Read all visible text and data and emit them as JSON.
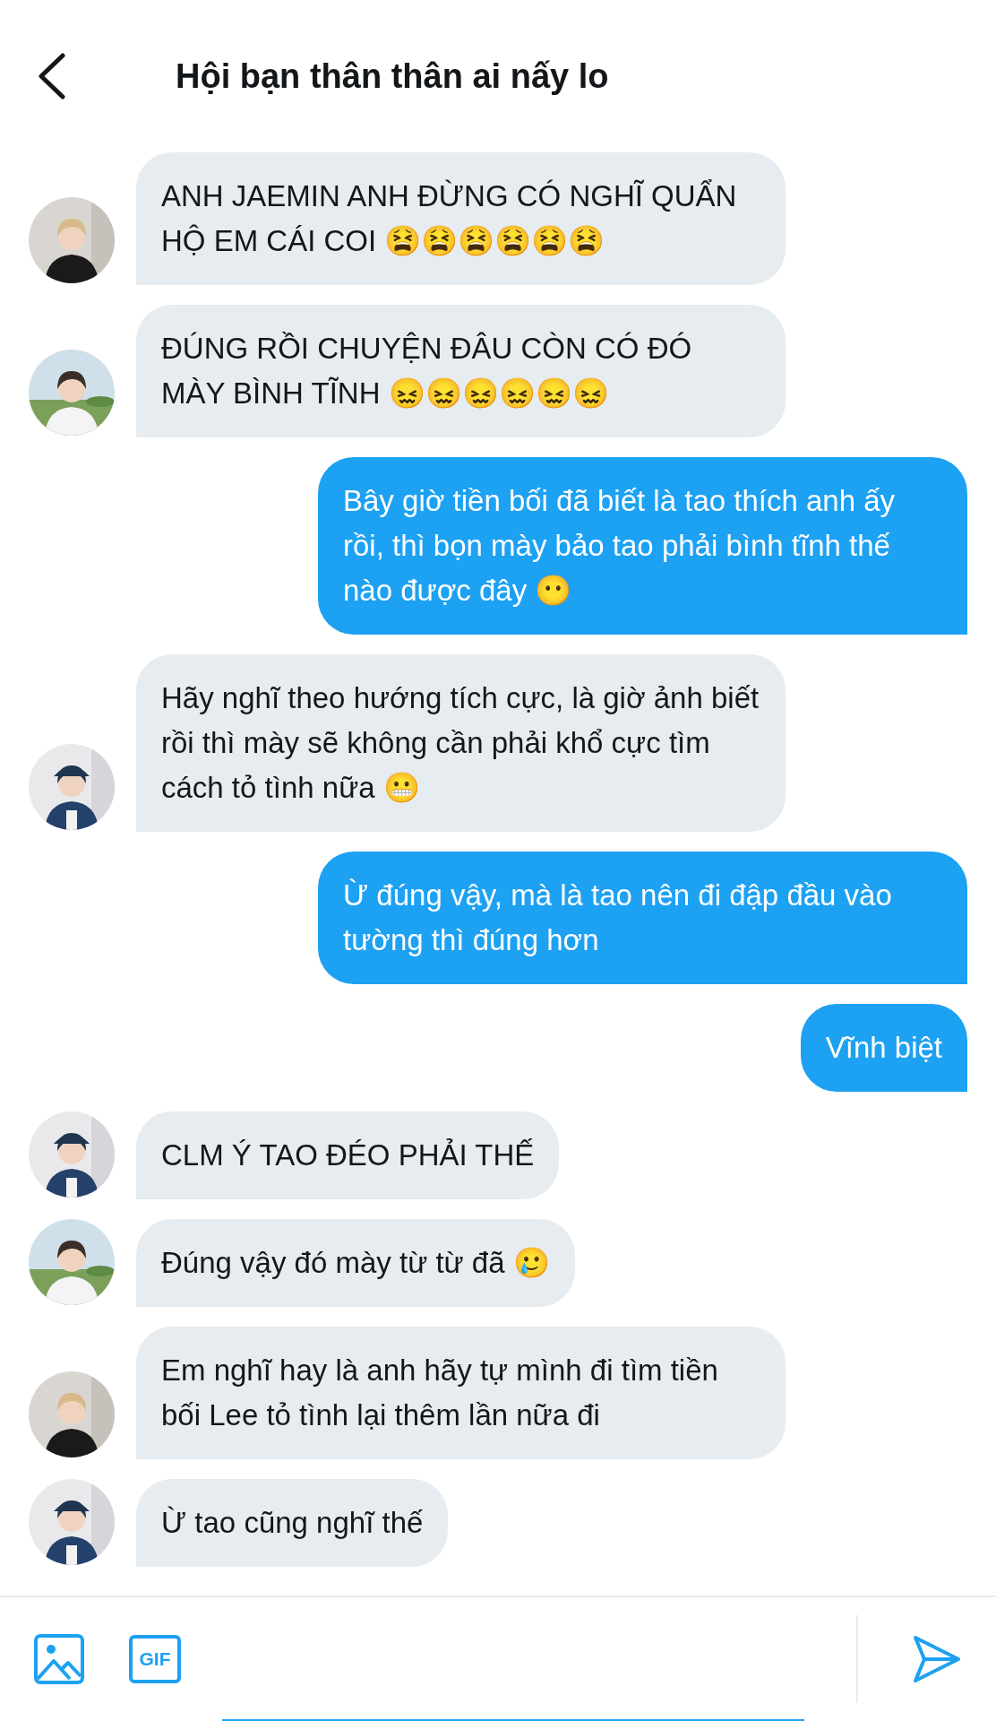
{
  "header": {
    "title": "Hội bạn thân thân ai nấy lo"
  },
  "messages": [
    {
      "kind": "received",
      "text": "ANH JAEMIN ANH ĐỪNG CÓ NGHĨ QUẨN HỘ EM CÁI COI 😫😫😫😫😫😫"
    },
    {
      "kind": "received",
      "text": "ĐÚNG RỒI CHUYỆN ĐÂU CÒN CÓ ĐÓ MÀY BÌNH TĨNH 😖😖😖😖😖😖"
    },
    {
      "kind": "sent",
      "text": "Bây giờ tiền bối đã biết là tao thích anh ấy rồi, thì bọn mày bảo tao phải bình tĩnh thế nào được đây 😶"
    },
    {
      "kind": "received",
      "text": "Hãy nghĩ theo hướng tích cực, là giờ ảnh biết rồi thì mày sẽ không cần phải khổ cực tìm cách tỏ tình nữa 😬"
    },
    {
      "kind": "sent",
      "text": "Ừ đúng vậy, mà là tao nên đi đập đầu vào tường thì đúng hơn"
    },
    {
      "kind": "sent",
      "text": "Vĩnh biệt"
    },
    {
      "kind": "received",
      "text": "CLM Ý TAO ĐÉO PHẢI THẾ"
    },
    {
      "kind": "received",
      "text": "Đúng vậy đó mày từ từ đã 🥲"
    },
    {
      "kind": "received",
      "text": "Em nghĩ hay là anh hãy tự mình đi tìm tiền bối Lee tỏ tình lại thêm lần nữa đi"
    },
    {
      "kind": "received",
      "text": "Ừ tao cũng nghĩ thế"
    }
  ],
  "compose": {
    "gif_label": "GIF"
  }
}
